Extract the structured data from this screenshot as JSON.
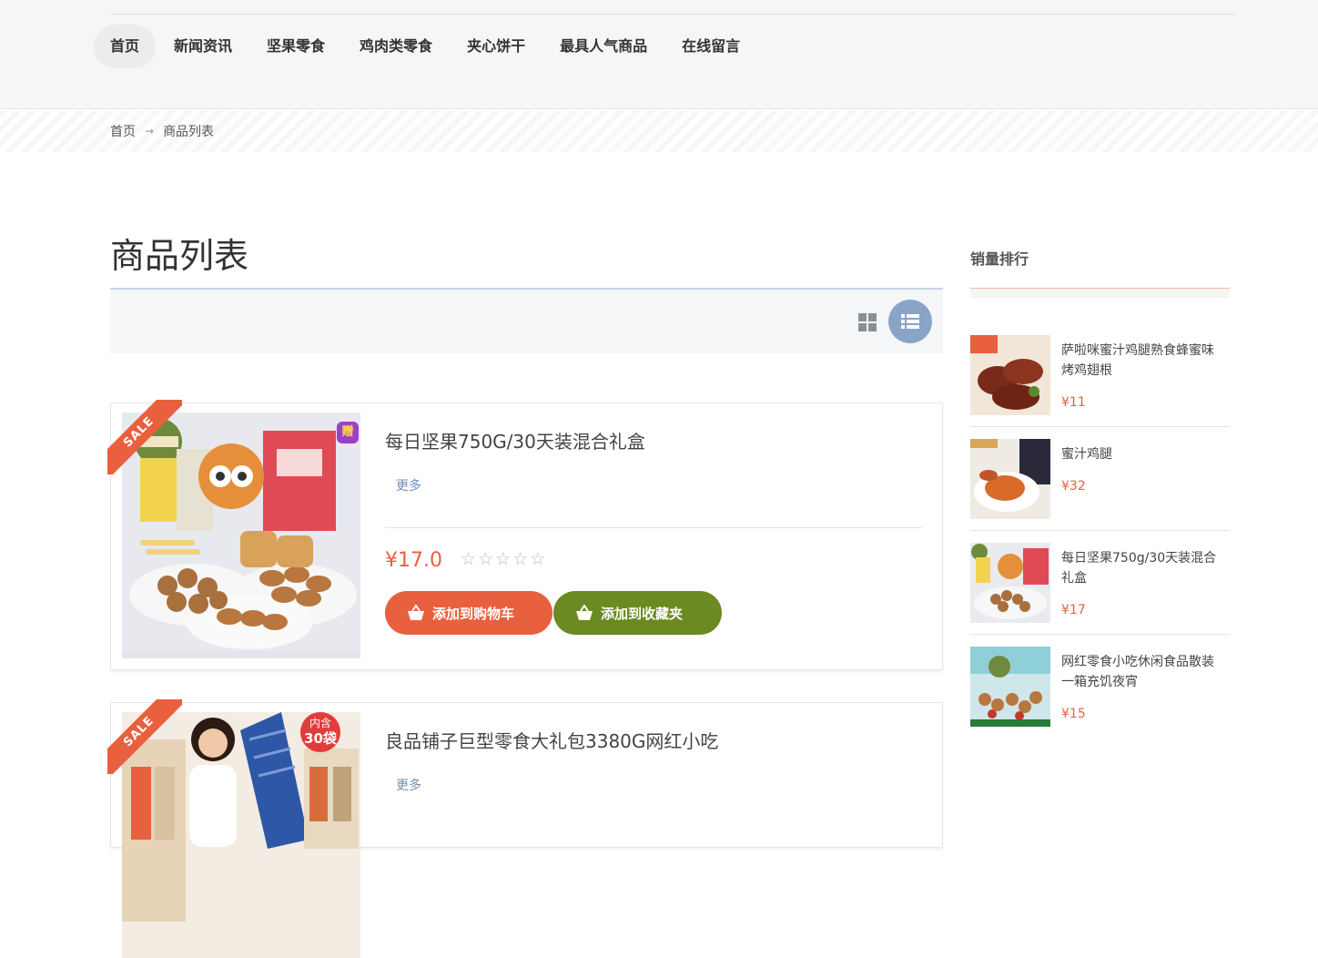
{
  "nav": {
    "items": [
      {
        "label": "首页",
        "active": true
      },
      {
        "label": "新闻资讯",
        "active": false
      },
      {
        "label": "坚果零食",
        "active": false
      },
      {
        "label": "鸡肉类零食",
        "active": false
      },
      {
        "label": "夹心饼干",
        "active": false
      },
      {
        "label": "最具人气商品",
        "active": false
      },
      {
        "label": "在线留言",
        "active": false
      }
    ]
  },
  "breadcrumb": {
    "home": "首页",
    "current": "商品列表"
  },
  "page": {
    "title": "商品列表"
  },
  "toolbar": {
    "grid_icon": "grid-view-icon",
    "list_icon": "list-view-icon"
  },
  "products": [
    {
      "badge": "SALE",
      "title": "每日坚果750G/30天装混合礼盒",
      "more": "更多",
      "price": "¥17.0",
      "rating": 0,
      "add_cart": "添加到购物车",
      "add_fav": "添加到收藏夹",
      "thumb_tag": "赠"
    },
    {
      "badge": "SALE",
      "title": "良品铺子巨型零食大礼包3380G网红小吃",
      "more": "更多",
      "thumb_tag_top": "内含",
      "thumb_tag_bottom": "30袋"
    }
  ],
  "sidebar": {
    "title": "销量排行",
    "items": [
      {
        "name": "萨啦咪蜜汁鸡腿熟食蜂蜜味烤鸡翅根",
        "price": "¥11"
      },
      {
        "name": "蜜汁鸡腿",
        "price": "¥32"
      },
      {
        "name": "每日坚果750g/30天装混合礼盒",
        "price": "¥17"
      },
      {
        "name": "网红零食小吃休闲食品散装一箱充饥夜宵",
        "price": "¥15"
      }
    ]
  },
  "colors": {
    "accent": "#e9603f",
    "fav": "#6b8a22",
    "link": "#6f8fb5",
    "list_btn": "#8aa4c8"
  }
}
